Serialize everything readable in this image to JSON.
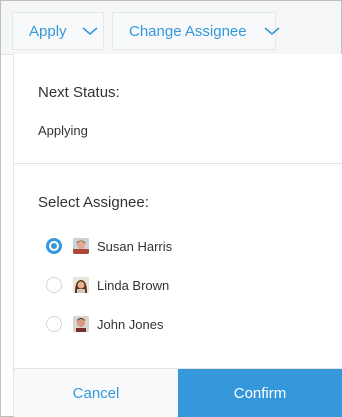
{
  "toolbar": {
    "apply_label": "Apply",
    "assignee_label": "Change Assignee"
  },
  "status": {
    "title": "Next Status:",
    "value": "Applying"
  },
  "assignee": {
    "title": "Select Assignee:",
    "options": [
      {
        "name": "Susan Harris",
        "selected": true,
        "avatar": "avatar-icon"
      },
      {
        "name": "Linda Brown",
        "selected": false,
        "avatar": "avatar-icon"
      },
      {
        "name": "John Jones",
        "selected": false,
        "avatar": "avatar-icon"
      }
    ]
  },
  "footer": {
    "cancel_label": "Cancel",
    "confirm_label": "Confirm"
  },
  "colors": {
    "accent": "#3498db",
    "text": "#333333",
    "toolbar_bg": "#f5f6f6"
  }
}
